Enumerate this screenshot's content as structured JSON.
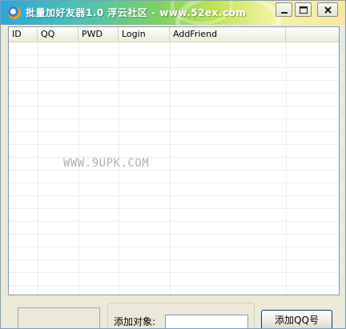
{
  "window": {
    "title": "批量加好友器1.0 浮云社区 - www.52ex.com",
    "colors": {
      "titlebar_start": "#2aa7d9",
      "titlebar_end": "#f9e79a",
      "face": "#ece9d8",
      "border": "#7f9db9"
    }
  },
  "titlebar_buttons": [
    {
      "name": "minimize",
      "icon": "minimize-icon"
    },
    {
      "name": "maximize",
      "icon": "maximize-icon"
    },
    {
      "name": "close",
      "icon": "close-icon"
    }
  ],
  "list": {
    "columns": [
      "ID",
      "QQ",
      "PWD",
      "Login",
      "AddFriend"
    ],
    "rows": []
  },
  "watermark": "WWW.9UPK.COM",
  "controls": {
    "target_label": "添加对象:",
    "target_value": "",
    "add_button_label": "添加QQ号"
  }
}
